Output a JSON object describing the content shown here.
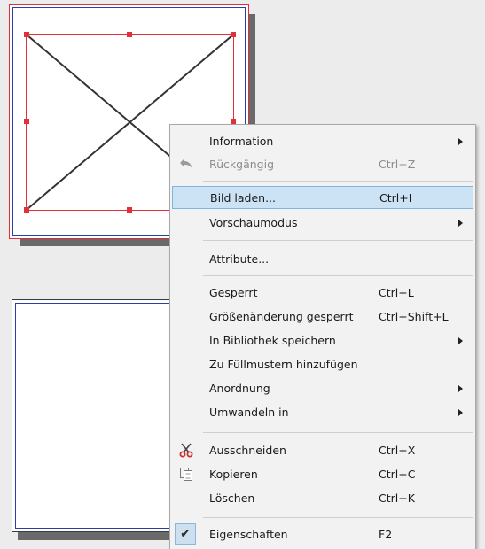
{
  "colors": {
    "selection": "#e0303a",
    "page_border": "#2c3ea8",
    "menu_bg": "#f2f2f2",
    "highlight_bg": "#cce3f5",
    "highlight_border": "#7fb4dd"
  },
  "canvas": {
    "pages": [
      {
        "name": "page-top",
        "has_image_placeholder": true,
        "selected": true
      },
      {
        "name": "page-bottom",
        "has_image_placeholder": false,
        "selected": false
      }
    ]
  },
  "menu": {
    "items": [
      {
        "name": "information",
        "label": "Information",
        "accel": "",
        "submenu": true,
        "disabled": false
      },
      {
        "name": "undo",
        "label": "Rückgängig",
        "accel": "Ctrl+Z",
        "submenu": false,
        "disabled": true,
        "icon": "undo-arrow-icon"
      },
      {
        "name": "load-image",
        "label": "Bild laden...",
        "accel": "Ctrl+I",
        "submenu": false,
        "disabled": false,
        "highlighted": true
      },
      {
        "name": "preview-mode",
        "label": "Vorschaumodus",
        "accel": "",
        "submenu": true,
        "disabled": false
      },
      {
        "name": "attributes",
        "label": "Attribute...",
        "accel": "",
        "submenu": false,
        "disabled": false
      },
      {
        "name": "locked",
        "label": "Gesperrt",
        "accel": "Ctrl+L",
        "submenu": false,
        "disabled": false
      },
      {
        "name": "size-locked",
        "label": "Größenänderung gesperrt",
        "accel": "Ctrl+Shift+L",
        "submenu": false,
        "disabled": false
      },
      {
        "name": "save-to-library",
        "label": "In Bibliothek speichern",
        "accel": "",
        "submenu": true,
        "disabled": false
      },
      {
        "name": "add-to-fill-patterns",
        "label": "Zu Füllmustern hinzufügen",
        "accel": "",
        "submenu": false,
        "disabled": false
      },
      {
        "name": "arrange",
        "label": "Anordnung",
        "accel": "",
        "submenu": true,
        "disabled": false
      },
      {
        "name": "convert-to",
        "label": "Umwandeln in",
        "accel": "",
        "submenu": true,
        "disabled": false
      },
      {
        "name": "cut",
        "label": "Ausschneiden",
        "accel": "Ctrl+X",
        "submenu": false,
        "disabled": false,
        "icon": "scissors-icon"
      },
      {
        "name": "copy",
        "label": "Kopieren",
        "accel": "Ctrl+C",
        "submenu": false,
        "disabled": false,
        "icon": "copy-icon"
      },
      {
        "name": "delete",
        "label": "Löschen",
        "accel": "Ctrl+K",
        "submenu": false,
        "disabled": false
      },
      {
        "name": "properties",
        "label": "Eigenschaften",
        "accel": "F2",
        "submenu": false,
        "disabled": false,
        "checked": true,
        "icon": "checkmark-icon"
      }
    ]
  }
}
